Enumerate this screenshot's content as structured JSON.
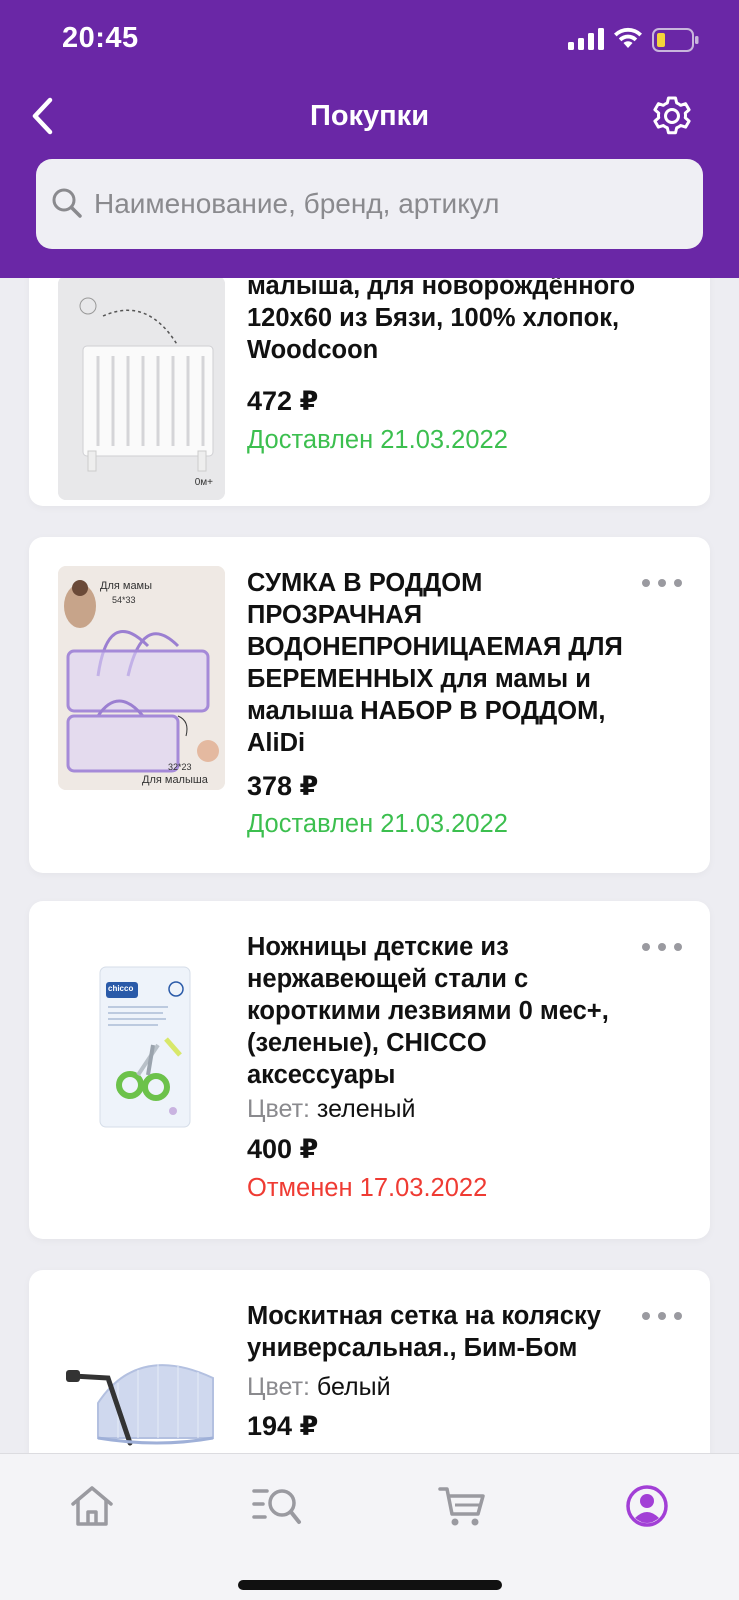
{
  "status_bar": {
    "time": "20:45"
  },
  "header": {
    "title": "Покупки",
    "search_placeholder": "Наименование, бренд, артикул"
  },
  "colors": {
    "brand": "#6a27a6",
    "delivered": "#3cbf4f",
    "cancelled": "#ef3b33",
    "active_tab": "#a23fd6"
  },
  "purchases": [
    {
      "title": "малыша, для новорождённого 120х60 из Бязи, 100% хлопок, Woodcoon",
      "price": "472 ₽",
      "status": "Доставлен 21.03.2022",
      "status_type": "delivered",
      "image_label": "0м+"
    },
    {
      "title": "СУМКА В РОДДОМ ПРОЗРАЧНАЯ ВОДОНЕПРОНИЦАЕМАЯ ДЛЯ БЕРЕМЕННЫХ для мамы и малыша НАБОР В РОДДОМ, AliDi",
      "price": "378 ₽",
      "status": "Доставлен 21.03.2022",
      "status_type": "delivered",
      "image_labels": {
        "mom": "Для мамы",
        "mom_size": "54*33",
        "baby": "Для малыша",
        "baby_size": "32*23"
      }
    },
    {
      "title": "Ножницы детские из нержавеющей стали с короткими лезвиями 0 мес+, (зеленые), CHICCO аксессуары",
      "color_label": "Цвет:",
      "color_value": "зеленый",
      "price": "400 ₽",
      "status": "Отменен 17.03.2022",
      "status_type": "cancelled",
      "image_label": "chicco"
    },
    {
      "title": "Москитная сетка на коляску универсальная., Бим-Бом",
      "color_label": "Цвет:",
      "color_value": "белый",
      "price": "194 ₽"
    }
  ],
  "tabbar": {
    "tabs": [
      {
        "icon": "home-icon"
      },
      {
        "icon": "catalog-search-icon"
      },
      {
        "icon": "cart-icon"
      },
      {
        "icon": "profile-icon",
        "active": true
      }
    ]
  }
}
